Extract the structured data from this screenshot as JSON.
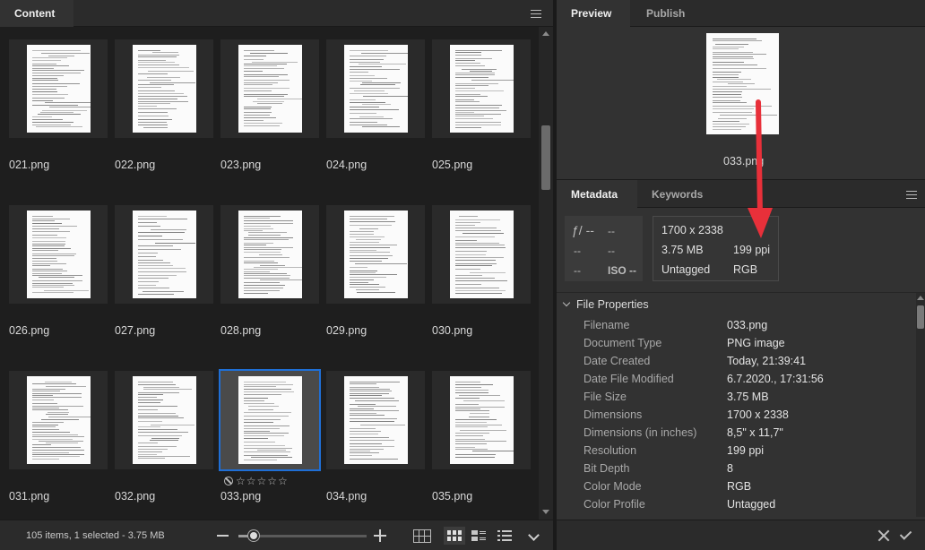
{
  "content_panel": {
    "tab_label": "Content",
    "thumbnails": [
      {
        "name": "021.png"
      },
      {
        "name": "022.png"
      },
      {
        "name": "023.png"
      },
      {
        "name": "024.png"
      },
      {
        "name": "025.png"
      },
      {
        "name": "026.png"
      },
      {
        "name": "027.png"
      },
      {
        "name": "028.png"
      },
      {
        "name": "029.png"
      },
      {
        "name": "030.png"
      },
      {
        "name": "031.png"
      },
      {
        "name": "032.png"
      },
      {
        "name": "033.png",
        "selected": true
      },
      {
        "name": "034.png"
      },
      {
        "name": "035.png"
      }
    ],
    "rating_stars": "☆☆☆☆☆",
    "status": "105 items, 1 selected - 3.75 MB"
  },
  "preview_panel": {
    "tabs": [
      {
        "label": "Preview"
      },
      {
        "label": "Publish"
      }
    ],
    "filename": "033.png"
  },
  "metadata_panel": {
    "tabs": [
      {
        "label": "Metadata"
      },
      {
        "label": "Keywords"
      }
    ],
    "exif": {
      "aperture": "ƒ/ --",
      "shutter": "--",
      "exposure_comp": "--",
      "wb": "--",
      "flash": "--",
      "iso": "ISO --"
    },
    "summary": {
      "dimensions": "1700 x 2338",
      "file_size": "3.75 MB",
      "resolution": "199 ppi",
      "color_profile": "Untagged",
      "color_mode": "RGB"
    },
    "section_title": "File Properties",
    "properties": [
      {
        "key": "Filename",
        "value": "033.png"
      },
      {
        "key": "Document Type",
        "value": "PNG image"
      },
      {
        "key": "Date Created",
        "value": "Today, 21:39:41"
      },
      {
        "key": "Date File Modified",
        "value": "6.7.2020., 17:31:56"
      },
      {
        "key": "File Size",
        "value": "3.75 MB"
      },
      {
        "key": "Dimensions",
        "value": "1700 x 2338"
      },
      {
        "key": "Dimensions (in inches)",
        "value": "8,5\" x 11,7\""
      },
      {
        "key": "Resolution",
        "value": "199 ppi"
      },
      {
        "key": "Bit Depth",
        "value": "8"
      },
      {
        "key": "Color Mode",
        "value": "RGB"
      },
      {
        "key": "Color Profile",
        "value": "Untagged"
      }
    ]
  },
  "colors": {
    "selection": "#1f6fd6",
    "annotation_arrow": "#e8303a"
  },
  "zoom_level": 0.12
}
